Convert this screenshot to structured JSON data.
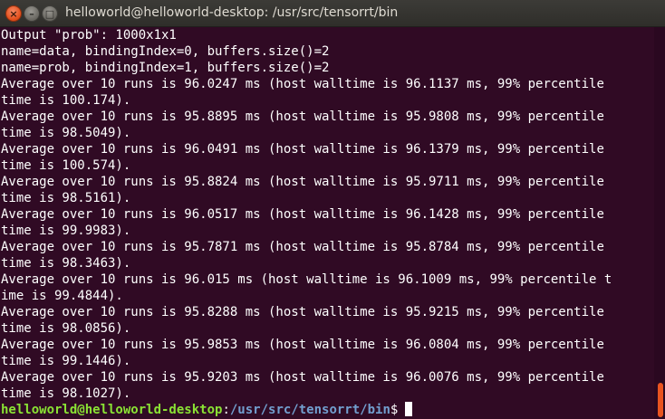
{
  "window": {
    "title": "helloworld@helloworld-desktop: /usr/src/tensorrt/bin",
    "close_glyph": "×",
    "minimize_glyph": "–",
    "maximize_glyph": "□"
  },
  "terminal": {
    "lines": [
      "Output \"prob\": 1000x1x1",
      "name=data, bindingIndex=0, buffers.size()=2",
      "name=prob, bindingIndex=1, buffers.size()=2",
      "Average over 10 runs is 96.0247 ms (host walltime is 96.1137 ms, 99% percentile",
      "time is 100.174).",
      "Average over 10 runs is 95.8895 ms (host walltime is 95.9808 ms, 99% percentile",
      "time is 98.5049).",
      "Average over 10 runs is 96.0491 ms (host walltime is 96.1379 ms, 99% percentile",
      "time is 100.574).",
      "Average over 10 runs is 95.8824 ms (host walltime is 95.9711 ms, 99% percentile",
      "time is 98.5161).",
      "Average over 10 runs is 96.0517 ms (host walltime is 96.1428 ms, 99% percentile",
      "time is 99.9983).",
      "Average over 10 runs is 95.7871 ms (host walltime is 95.8784 ms, 99% percentile",
      "time is 98.3463).",
      "Average over 10 runs is 96.015 ms (host walltime is 96.1009 ms, 99% percentile t",
      "ime is 99.4844).",
      "Average over 10 runs is 95.8288 ms (host walltime is 95.9215 ms, 99% percentile",
      "time is 98.0856).",
      "Average over 10 runs is 95.9853 ms (host walltime is 96.0804 ms, 99% percentile",
      "time is 99.1446).",
      "Average over 10 runs is 95.9203 ms (host walltime is 96.0076 ms, 99% percentile",
      "time is 98.1027)."
    ],
    "prompt": {
      "user_host": "helloworld@helloworld-desktop",
      "separator": ":",
      "path": "/usr/src/tensorrt/bin",
      "symbol": "$"
    }
  },
  "colors": {
    "background": "#300a24",
    "text": "#ffffff",
    "prompt_user": "#8ae234",
    "prompt_path": "#729fcf",
    "accent": "#e95420"
  }
}
